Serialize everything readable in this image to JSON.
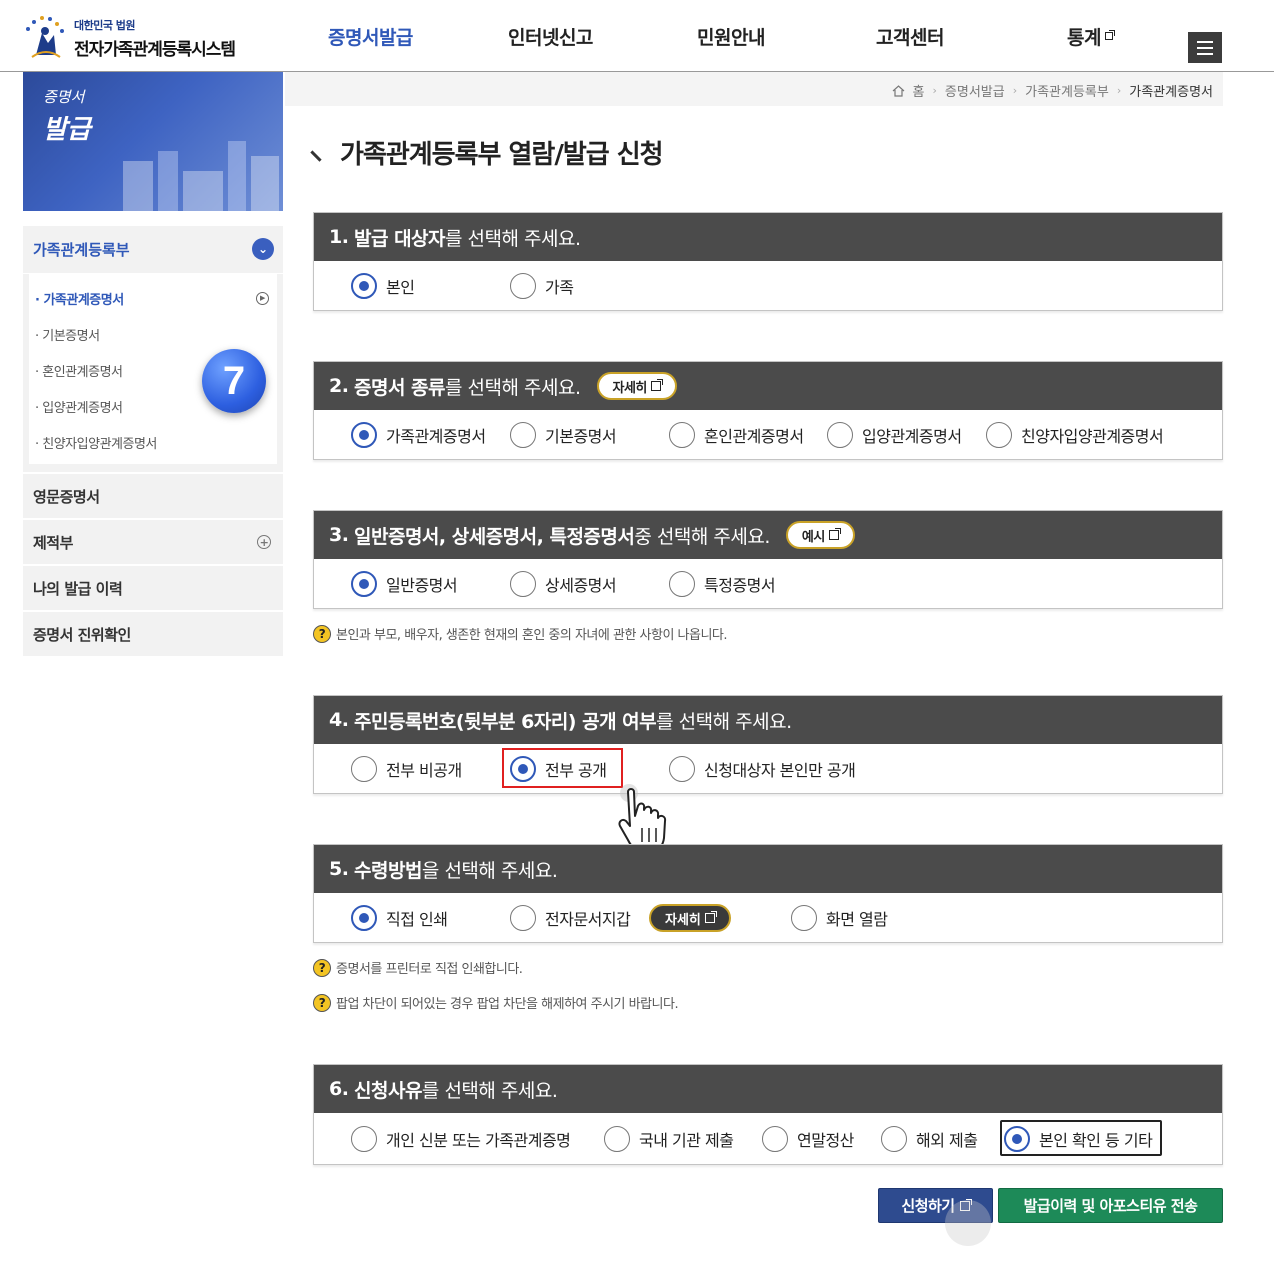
{
  "header": {
    "logo_small": "대한민국 법원",
    "logo_big": "전자가족관계등록시스템",
    "nav": [
      {
        "label": "증명서발급"
      },
      {
        "label": "인터넷신고"
      },
      {
        "label": "민원안내"
      },
      {
        "label": "고객센터"
      },
      {
        "label": "통계"
      }
    ]
  },
  "banner": {
    "line1": "증명서",
    "line2": "발급"
  },
  "sidebar": {
    "head": "가족관계등록부",
    "sub_items": [
      {
        "label": "· 가족관계증명서"
      },
      {
        "label": "· 기본증명서"
      },
      {
        "label": "· 혼인관계증명서"
      },
      {
        "label": "· 입양관계증명서"
      },
      {
        "label": "· 친양자입양관계증명서"
      }
    ],
    "items": [
      {
        "label": "영문증명서"
      },
      {
        "label": "제적부"
      },
      {
        "label": "나의 발급 이력"
      },
      {
        "label": "증명서 진위확인"
      }
    ]
  },
  "step_badge": "7",
  "breadcrumb": {
    "home": "홈",
    "c1": "증명서발급",
    "c2": "가족관계등록부",
    "current": "가족관계증명서"
  },
  "page_title": "가족관계등록부 열람/발급 신청",
  "sections": [
    {
      "num": "1.",
      "bold": "발급 대상자",
      "rest": "를 선택해 주세요.",
      "options": [
        "본인",
        "가족"
      ],
      "selected": 0
    },
    {
      "num": "2.",
      "bold": "증명서 종류",
      "rest": "를 선택해 주세요.",
      "pill": "자세히",
      "options": [
        "가족관계증명서",
        "기본증명서",
        "혼인관계증명서",
        "입양관계증명서",
        "친양자입양관계증명서"
      ],
      "selected": 0
    },
    {
      "num": "3.",
      "bold": "일반증명서, 상세증명서, 특정증명서",
      "rest": " 중 선택해 주세요.",
      "pill": "예시",
      "options": [
        "일반증명서",
        "상세증명서",
        "특정증명서"
      ],
      "selected": 0
    },
    {
      "num": "4.",
      "bold": "주민등록번호(뒷부분 6자리) 공개 여부",
      "rest": "를 선택해 주세요.",
      "options": [
        "전부 비공개",
        "전부 공개",
        "신청대상자 본인만 공개"
      ],
      "selected": 1
    },
    {
      "num": "5.",
      "bold": "수령방법",
      "rest": "을 선택해 주세요.",
      "pill": "자세히",
      "options": [
        "직접 인쇄",
        "전자문서지갑",
        "화면 열람"
      ],
      "selected": 0
    },
    {
      "num": "6.",
      "bold": "신청사유",
      "rest": "를 선택해 주세요.",
      "options": [
        "개인 신분 또는 가족관계증명",
        "국내 기관 제출",
        "연말정산",
        "해외 제출",
        "본인 확인 등 기타"
      ],
      "selected": 4
    }
  ],
  "hints": {
    "s3": "본인과 부모, 배우자, 생존한 현재의 혼인 중의 자녀에 관한 사항이 나옵니다.",
    "s5a": "증명서를 프린터로 직접 인쇄합니다.",
    "s5b": "팝업 차단이 되어있는 경우 팝업 차단을 해제하여 주시기 바랍니다."
  },
  "buttons": {
    "apply": "신청하기",
    "send": "발급이력 및 아포스티유 전송"
  },
  "colors": {
    "accent": "#2f58b8",
    "section_header": "#4b4b4b",
    "highlight": "#e02020",
    "send": "#1d8a58",
    "apply": "#2e4b8f"
  }
}
